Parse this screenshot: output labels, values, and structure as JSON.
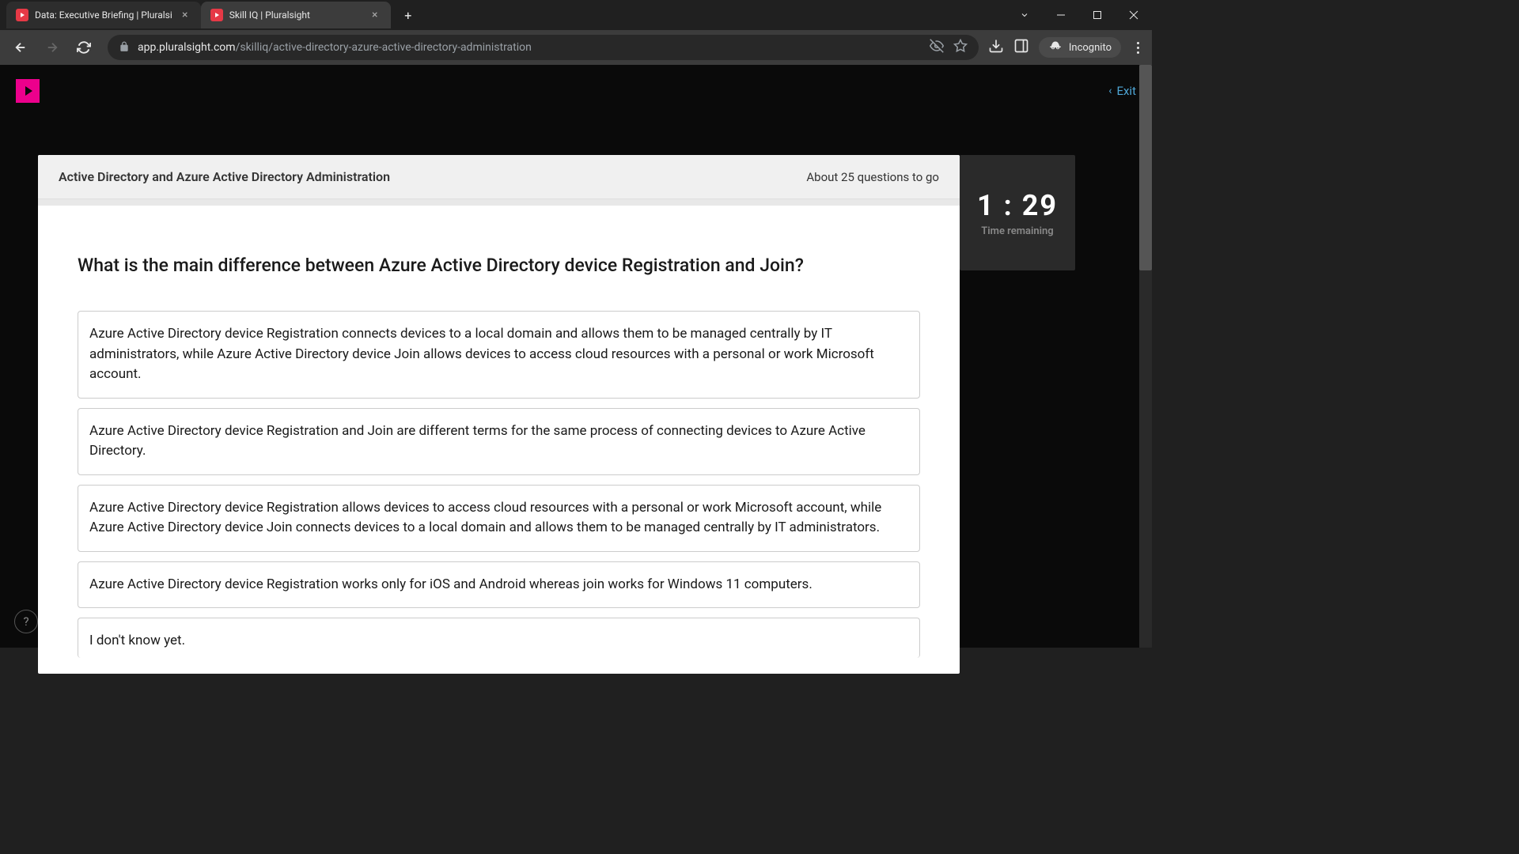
{
  "browser": {
    "tabs": [
      {
        "title": "Data: Executive Briefing | Pluralsi",
        "active": false
      },
      {
        "title": "Skill IQ | Pluralsight",
        "active": true
      }
    ],
    "url_domain": "app.pluralsight.com",
    "url_path": "/skilliq/active-directory-azure-active-directory-administration",
    "incognito_label": "Incognito"
  },
  "header": {
    "exit_label": "Exit"
  },
  "quiz": {
    "title": "Active Directory and Azure Active Directory Administration",
    "progress": "About 25 questions to go",
    "question": "What is the main difference between Azure Active Directory device Registration and Join?",
    "answers": [
      "Azure Active Directory device Registration connects devices to a local domain and allows them to be managed centrally by IT administrators, while Azure Active Directory device Join allows devices to access cloud resources with a personal or work Microsoft account.",
      "Azure Active Directory device Registration and Join are different terms for the same process of connecting devices to Azure Active Directory.",
      "Azure Active Directory device Registration allows devices to access cloud resources with a personal or work Microsoft account, while Azure Active Directory device Join connects devices to a local domain and allows them to be managed centrally by IT administrators.",
      "Azure Active Directory device Registration works only for iOS and Android whereas join works for Windows 11 computers.",
      "I don't know yet."
    ]
  },
  "timer": {
    "value": "1 : 29",
    "label": "Time remaining"
  },
  "help": {
    "symbol": "?"
  }
}
